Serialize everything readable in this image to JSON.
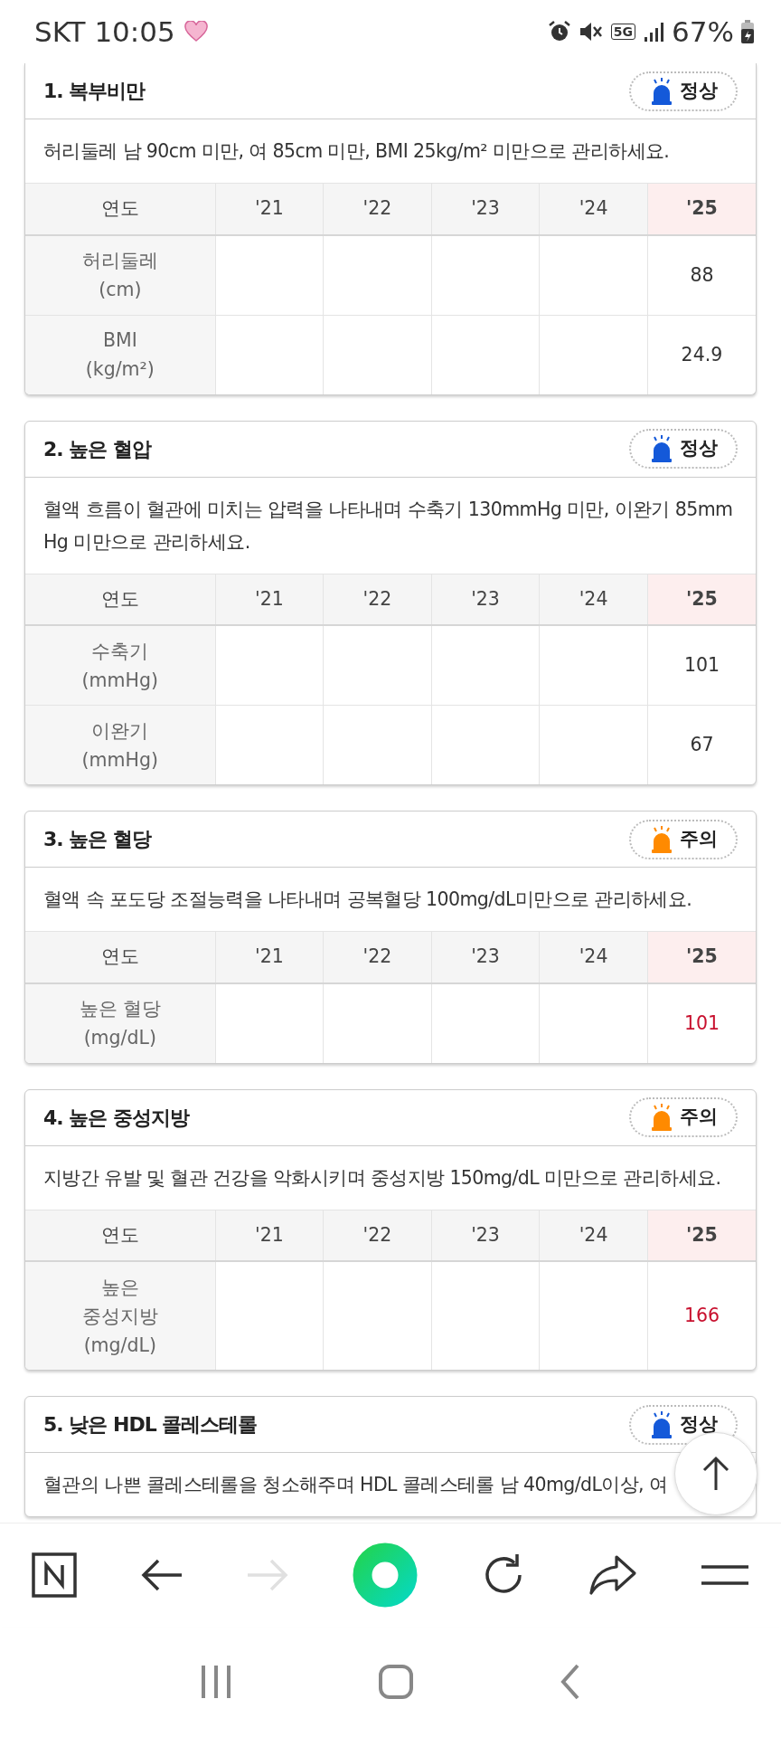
{
  "status_bar": {
    "carrier_time": "SKT 10:05",
    "network": "5G",
    "battery": "67%"
  },
  "cards": [
    {
      "title": "1. 복부비만",
      "status": {
        "label": "정상",
        "kind": "normal"
      },
      "description": "허리둘레 남 90cm 미만, 여 85cm 미만, BMI 25kg/m² 미만으로 관리하세요.",
      "columns": [
        {
          "label": "연도",
          "current": false
        },
        {
          "label": "'21",
          "current": false
        },
        {
          "label": "'22",
          "current": false
        },
        {
          "label": "'23",
          "current": false
        },
        {
          "label": "'24",
          "current": false
        },
        {
          "label": "'25",
          "current": true
        }
      ],
      "rows": [
        {
          "label": [
            "허리둘레",
            "(cm)"
          ],
          "values": [
            "88"
          ]
        },
        {
          "label": [
            "BMI",
            "(kg/m²)"
          ],
          "values": [
            "24.9"
          ]
        }
      ]
    },
    {
      "title": "2. 높은 혈압",
      "status": {
        "label": "정상",
        "kind": "normal"
      },
      "description": "혈액 흐름이 혈관에 미치는 압력을 나타내며 수축기 130mmHg 미만, 이완기 85mmHg 미만으로 관리하세요.",
      "columns": [
        {
          "label": "연도",
          "current": false
        },
        {
          "label": "'21",
          "current": false
        },
        {
          "label": "'22",
          "current": false
        },
        {
          "label": "'23",
          "current": false
        },
        {
          "label": "'24",
          "current": false
        },
        {
          "label": "'25",
          "current": true
        }
      ],
      "rows": [
        {
          "label": [
            "수축기",
            "(mmHg)"
          ],
          "values": [
            "101"
          ]
        },
        {
          "label": [
            "이완기",
            "(mmHg)"
          ],
          "values": [
            "67"
          ]
        }
      ]
    },
    {
      "title": "3. 높은 혈당",
      "status": {
        "label": "주의",
        "kind": "caution"
      },
      "description": "혈액 속 포도당 조절능력을 나타내며 공복혈당 100mg/dL미만으로 관리하세요.",
      "columns": [
        {
          "label": "연도",
          "current": false
        },
        {
          "label": "'21",
          "current": false
        },
        {
          "label": "'22",
          "current": false
        },
        {
          "label": "'23",
          "current": false
        },
        {
          "label": "'24",
          "current": false
        },
        {
          "label": "'25",
          "current": true
        }
      ],
      "rows": [
        {
          "label": [
            "높은 혈당",
            "(mg/dL)"
          ],
          "values": [
            "101"
          ]
        }
      ]
    },
    {
      "title": "4. 높은 중성지방",
      "status": {
        "label": "주의",
        "kind": "caution"
      },
      "description": "지방간 유발 및 혈관 건강을 악화시키며 중성지방 150mg/dL 미만으로 관리하세요.",
      "columns": [
        {
          "label": "연도",
          "current": false
        },
        {
          "label": "'21",
          "current": false
        },
        {
          "label": "'22",
          "current": false
        },
        {
          "label": "'23",
          "current": false
        },
        {
          "label": "'24",
          "current": false
        },
        {
          "label": "'25",
          "current": true
        }
      ],
      "rows": [
        {
          "label": [
            "높은",
            "중성지방",
            "(mg/dL)"
          ],
          "values": [
            "166"
          ]
        }
      ]
    },
    {
      "title": "5. 낮은 HDL 콜레스테롤",
      "status": {
        "label": "정상",
        "kind": "normal"
      },
      "description": "혈관의 나쁜 콜레스테롤을 청소해주며 HDL 콜레스테롤 남 40mg/dL이상, 여"
    }
  ],
  "toolbar": [
    {
      "kind": "home",
      "disabled": false
    },
    {
      "kind": "back",
      "disabled": false
    },
    {
      "kind": "forward",
      "disabled": true
    },
    {
      "kind": "green",
      "disabled": false
    },
    {
      "kind": "reload",
      "disabled": false
    },
    {
      "kind": "share",
      "disabled": false
    },
    {
      "kind": "menu",
      "disabled": false
    }
  ]
}
